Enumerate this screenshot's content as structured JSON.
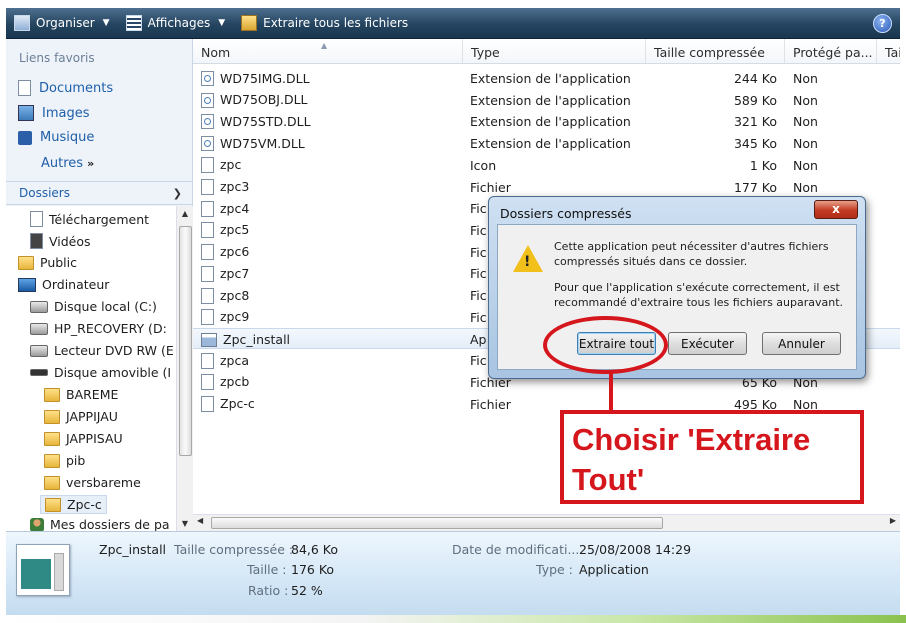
{
  "toolbar": {
    "organiser": "Organiser",
    "affichages": "Affichages",
    "extract_all": "Extraire tous les fichiers",
    "help": "?"
  },
  "left_panel": {
    "favorites_title": "Liens favoris",
    "favorites": [
      "Documents",
      "Images",
      "Musique"
    ],
    "more_label": "Autres",
    "more_arrows": "»",
    "folders_title": "Dossiers",
    "tree": [
      {
        "label": "Téléchargement",
        "icon": "document-icon"
      },
      {
        "label": "Vidéos",
        "icon": "video-icon"
      },
      {
        "label": "Public",
        "icon": "folder-icon"
      },
      {
        "label": "Ordinateur",
        "icon": "computer-icon"
      },
      {
        "label": "Disque local (C:)",
        "icon": "drive-icon"
      },
      {
        "label": "HP_RECOVERY (D:",
        "icon": "drive-icon"
      },
      {
        "label": "Lecteur DVD RW (E",
        "icon": "dvd-drive-icon"
      },
      {
        "label": "Disque amovible (I",
        "icon": "removable-drive-icon"
      },
      {
        "label": "BAREME",
        "icon": "folder-icon"
      },
      {
        "label": "JAPPIJAU",
        "icon": "folder-icon"
      },
      {
        "label": "JAPPISAU",
        "icon": "folder-icon"
      },
      {
        "label": "pib",
        "icon": "folder-icon"
      },
      {
        "label": "versbareme",
        "icon": "folder-icon"
      },
      {
        "label": "Zpc-c",
        "icon": "folder-icon"
      },
      {
        "label": "Mes dossiers de pa",
        "icon": "user-folder-icon"
      }
    ]
  },
  "columns": [
    "Nom",
    "Type",
    "Taille compressée",
    "Protégé pa...",
    "Tai"
  ],
  "files": [
    {
      "name": "WD75IMG.DLL",
      "type": "Extension de l'application",
      "size": "244 Ko",
      "protected": "Non",
      "icon": "dll-icon"
    },
    {
      "name": "WD75OBJ.DLL",
      "type": "Extension de l'application",
      "size": "589 Ko",
      "protected": "Non",
      "icon": "dll-icon"
    },
    {
      "name": "WD75STD.DLL",
      "type": "Extension de l'application",
      "size": "321 Ko",
      "protected": "Non",
      "icon": "dll-icon"
    },
    {
      "name": "WD75VM.DLL",
      "type": "Extension de l'application",
      "size": "345 Ko",
      "protected": "Non",
      "icon": "dll-icon"
    },
    {
      "name": "zpc",
      "type": "Icon",
      "size": "1 Ko",
      "protected": "Non",
      "icon": "file-icon"
    },
    {
      "name": "zpc3",
      "type": "Fichier",
      "size": "177 Ko",
      "protected": "Non",
      "icon": "file-icon"
    },
    {
      "name": "zpc4",
      "type": "Fic",
      "size": "",
      "protected": "",
      "icon": "file-icon"
    },
    {
      "name": "zpc5",
      "type": "Fic",
      "size": "",
      "protected": "",
      "icon": "file-icon"
    },
    {
      "name": "zpc6",
      "type": "Fic",
      "size": "",
      "protected": "",
      "icon": "file-icon"
    },
    {
      "name": "zpc7",
      "type": "Fic",
      "size": "",
      "protected": "",
      "icon": "file-icon"
    },
    {
      "name": "zpc8",
      "type": "Fic",
      "size": "",
      "protected": "",
      "icon": "file-icon"
    },
    {
      "name": "zpc9",
      "type": "Fic",
      "size": "",
      "protected": "",
      "icon": "file-icon"
    },
    {
      "name": "Zpc_install",
      "type": "Ap",
      "size": "",
      "protected": "",
      "icon": "exe-icon"
    },
    {
      "name": "zpca",
      "type": "Fic",
      "size": "",
      "protected": "",
      "icon": "file-icon"
    },
    {
      "name": "zpcb",
      "type": "Fichier",
      "size": "65 Ko",
      "protected": "Non",
      "icon": "file-icon"
    },
    {
      "name": "Zpc-c",
      "type": "Fichier",
      "size": "495 Ko",
      "protected": "Non",
      "icon": "file-icon"
    }
  ],
  "selected_file": "Zpc_install",
  "details": {
    "name": "Zpc_install",
    "compressed_label": "Taille compressée :",
    "compressed_value": "84,6 Ko",
    "size_label": "Taille :",
    "size_value": "176 Ko",
    "ratio_label": "Ratio :",
    "ratio_value": "52 %",
    "modified_label": "Date de modificati...",
    "modified_value": "25/08/2008 14:29",
    "type_label": "Type :",
    "type_value": "Application"
  },
  "dialog": {
    "title": "Dossiers compressés",
    "close": "x",
    "message_line1": "Cette application peut nécessiter d'autres fichiers",
    "message_line2": "compressés situés dans ce dossier.",
    "message_line3": "Pour que l'application s'exécute correctement, il est",
    "message_line4": "recommandé d'extraire tous les fichiers auparavant.",
    "btn_extract": "Extraire tout",
    "btn_execute": "Exécuter",
    "btn_cancel": "Annuler"
  },
  "annotation": {
    "line1": "Choisir 'Extraire",
    "line2": "Tout'",
    "color": "#d5161c"
  }
}
